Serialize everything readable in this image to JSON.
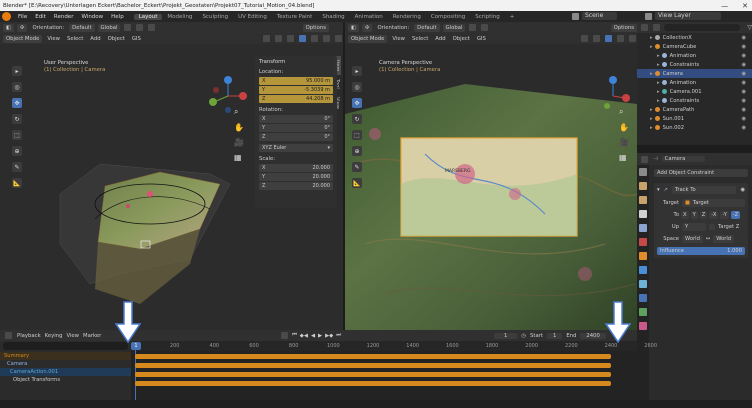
{
  "window": {
    "title": "Blender* [E:\\Recovery\\Unterlagen Eckert\\Bachelor_Eckert\\Projekt_Geostaten\\Projekt07_Tutorial_Motion_04.blend]",
    "minimize": "—",
    "close": "✕"
  },
  "menubar": {
    "items": [
      "File",
      "Edit",
      "Render",
      "Window",
      "Help"
    ],
    "workspaces": [
      "Layout",
      "Modeling",
      "Sculpting",
      "UV Editing",
      "Texture Paint",
      "Shading",
      "Animation",
      "Rendering",
      "Compositing",
      "Scripting"
    ],
    "active_workspace": "Layout",
    "plus": "+",
    "scene_label": "Scene",
    "viewlayer_label": "View Layer"
  },
  "viewport_left": {
    "header1": {
      "orientation_label": "Orientation:",
      "default_label": "Default",
      "global_label": "Global",
      "options_label": "Options"
    },
    "header2": {
      "mode": "Object Mode",
      "view": "View",
      "select": "Select",
      "add": "Add",
      "object": "Object",
      "gis": "GIS"
    },
    "info_title": "User Perspective",
    "info_collection": "(1) Collection | Camera"
  },
  "viewport_right": {
    "header1": {
      "orientation_label": "Orientation:",
      "default_label": "Default",
      "global_label": "Global",
      "options_label": "Options"
    },
    "header2": {
      "mode": "Object Mode",
      "view": "View",
      "select": "Select",
      "add": "Add",
      "object": "Object",
      "gis": "GIS"
    },
    "info_title": "Camera Perspective",
    "info_collection": "(1) Collection | Camera",
    "map_label": "MARSBERG"
  },
  "npanel": {
    "title": "Transform",
    "location_label": "Location:",
    "location": [
      {
        "axis": "X",
        "value": "95.000 m"
      },
      {
        "axis": "Y",
        "value": "-5.3039 m"
      },
      {
        "axis": "Z",
        "value": "44.208 m"
      }
    ],
    "rotation_label": "Rotation:",
    "rotation": [
      {
        "axis": "X",
        "value": "0°"
      },
      {
        "axis": "Y",
        "value": "0°"
      },
      {
        "axis": "Z",
        "value": "0°"
      }
    ],
    "rotation_mode": "XYZ Euler",
    "scale_label": "Scale:",
    "scale": [
      {
        "axis": "X",
        "value": "20.000"
      },
      {
        "axis": "Y",
        "value": "20.000"
      },
      {
        "axis": "Z",
        "value": "20.000"
      }
    ],
    "tabs": [
      "Item",
      "Tool",
      "View"
    ]
  },
  "outliner": {
    "search_placeholder": "",
    "items": [
      {
        "label": "CollectionX",
        "indent": 1,
        "color": "#aaaaaa",
        "selected": false
      },
      {
        "label": "CameraCube",
        "indent": 1,
        "color": "#e08c2b",
        "selected": false
      },
      {
        "label": "Animation",
        "indent": 2,
        "color": "#9bb3d9",
        "selected": false
      },
      {
        "label": "Constraints",
        "indent": 2,
        "color": "#9bb3d9",
        "selected": false
      },
      {
        "label": "Camera",
        "indent": 1,
        "color": "#e08c2b",
        "selected": true
      },
      {
        "label": "Animation",
        "indent": 2,
        "color": "#9bb3d9",
        "selected": false
      },
      {
        "label": "Camera.001",
        "indent": 2,
        "color": "#4fb0a8",
        "selected": false
      },
      {
        "label": "Constraints",
        "indent": 2,
        "color": "#9bb3d9",
        "selected": false
      },
      {
        "label": "CameraPath",
        "indent": 1,
        "color": "#e08c2b",
        "selected": false
      },
      {
        "label": "Sun.001",
        "indent": 1,
        "color": "#e08c2b",
        "selected": false
      },
      {
        "label": "Sun.002",
        "indent": 1,
        "color": "#e08c2b",
        "selected": false
      }
    ]
  },
  "properties": {
    "object_name": "Camera",
    "add_constraint": "Add Object Constraint",
    "constraint_name": "Track To",
    "target_label": "Target",
    "target_value": "Target",
    "to_label": "To",
    "axes": [
      "X",
      "Y",
      "Z",
      "-X",
      "-Y",
      "-Z"
    ],
    "up_label": "Up",
    "up_value": "Y",
    "target_z_label": "Target Z",
    "space_label": "Space",
    "world_label": "World",
    "world_label_2": "World",
    "influence_label": "Influence",
    "influence_value": "1.000"
  },
  "timeline": {
    "header": {
      "playback": "Playback",
      "keying": "Keying",
      "view": "View",
      "marker": "Marker",
      "frame_current": "1",
      "start_label": "Start",
      "start_value": "1",
      "end_label": "End",
      "end_value": "2400"
    },
    "current_frame_badge": "1",
    "ticks": [
      "200",
      "400",
      "600",
      "800",
      "1000",
      "1200",
      "1400",
      "1600",
      "1800",
      "2000",
      "2200",
      "2400",
      "2600"
    ],
    "channels": [
      {
        "label": "Summary",
        "color": "#d68a1e"
      },
      {
        "label": "Camera",
        "color": "#8fb3e6"
      },
      {
        "label": "CameraAction.001",
        "color": "#5fa6d6"
      },
      {
        "label": "Object Transforms",
        "color": "#cfcfcf"
      }
    ],
    "keyframe_rows": 4
  },
  "colors": {
    "accent": "#4772b3",
    "keyframe": "#d68a1e",
    "location_field": "#b5963a",
    "selection": "#334d80"
  },
  "icons": [
    "blender-logo-icon",
    "cursor-icon",
    "move-icon",
    "rotate-icon",
    "scale-icon",
    "transform-icon",
    "annotate-icon",
    "measure-icon",
    "camera-icon",
    "hand-icon",
    "zoom-icon",
    "play-icon",
    "arrow-down-icon"
  ]
}
